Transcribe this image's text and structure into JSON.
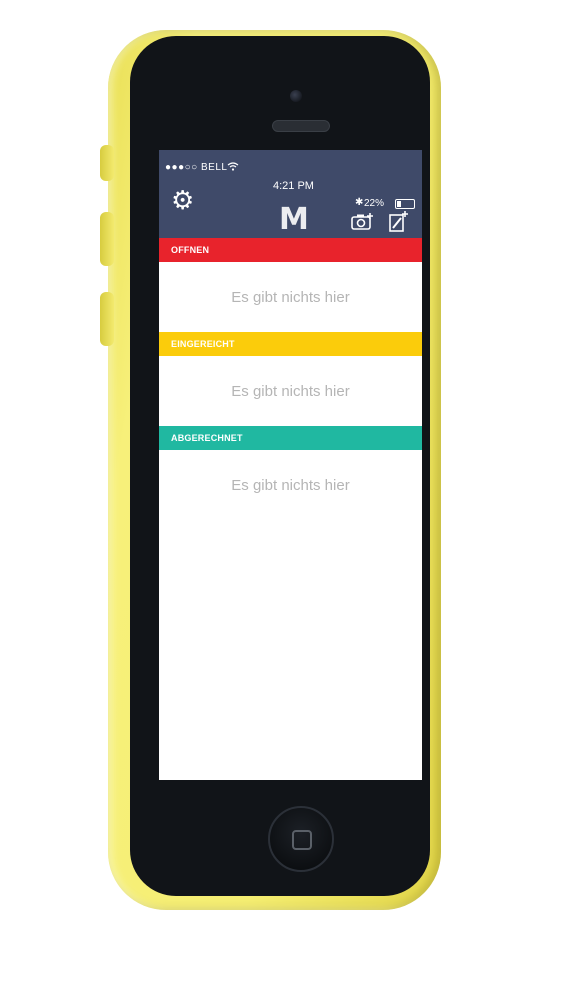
{
  "status_bar": {
    "carrier": "●●●○○ BELL",
    "time": "4:21 PM",
    "battery_percent": "22%"
  },
  "header": {
    "logo": "M",
    "settings_icon": "gear-icon",
    "camera_add_icon": "camera-add-icon",
    "document_add_icon": "document-edit-add-icon"
  },
  "sections": [
    {
      "title": "OFFNEN",
      "color": "#e8232c",
      "empty_text": "Es gibt nichts hier"
    },
    {
      "title": "EINGEREICHT",
      "color": "#fbcc0b",
      "empty_text": "Es gibt nichts hier"
    },
    {
      "title": "ABGERECHNET",
      "color": "#20b8a1",
      "empty_text": "Es gibt nichts hier"
    }
  ],
  "colors": {
    "header_bg": "#3f4a69",
    "phone_shell": "#f3ea6e"
  }
}
